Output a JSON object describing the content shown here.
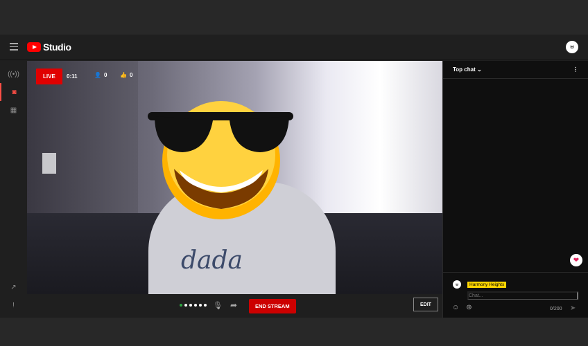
{
  "header": {
    "brand": "Studio",
    "account_initials": "ㅂ"
  },
  "rail": {
    "items": [
      "live",
      "camera",
      "calendar"
    ],
    "bottom_items": [
      "external-link",
      "feedback"
    ]
  },
  "stream": {
    "live_label": "LIVE",
    "elapsed": "0:11",
    "viewers": "0",
    "likes": "0",
    "shirt_text": "dada"
  },
  "controls": {
    "end_label": "END STREAM",
    "edit_label": "EDIT"
  },
  "chat": {
    "mode": "Top chat",
    "user_name": "Harmony Heights",
    "input_placeholder": "Chat...",
    "char_count": "0/200"
  },
  "colors": {
    "live_red": "#e00000",
    "end_red": "#cc0000",
    "name_highlight": "#ffd600"
  }
}
